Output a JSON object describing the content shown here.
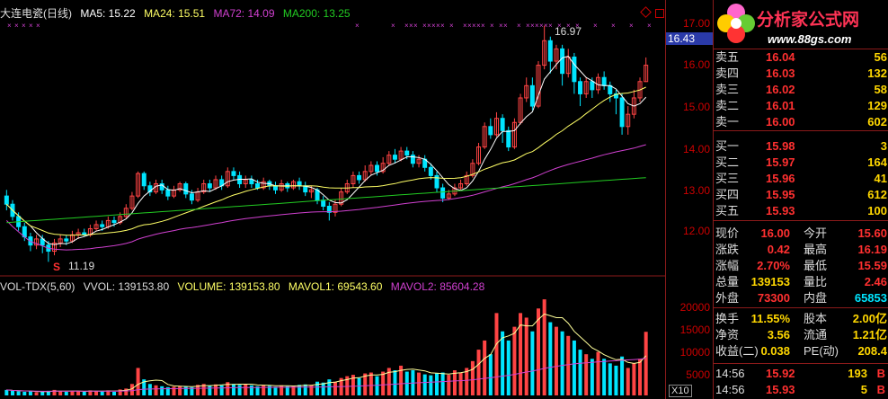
{
  "chart_header": {
    "title": "大连电瓷(日线)",
    "ma5": "MA5: 15.22",
    "ma24": "MA24: 15.51",
    "ma72": "MA72: 14.09",
    "ma200": "MA200: 13.25"
  },
  "volume_header": {
    "indicator": "VOL-TDX(5,60)",
    "vvol": "VVOL: 139153.80",
    "volume": "VOLUME: 139153.80",
    "mavol1": "MAVOL1: 69543.60",
    "mavol2": "MAVOL2: 85604.28"
  },
  "annotations": {
    "high": "16.97",
    "low": "11.19",
    "signal": "S"
  },
  "price_axis": {
    "ticks": [
      "17.00",
      "16.00",
      "15.00",
      "14.00",
      "13.00",
      "12.00"
    ],
    "current": "16.43"
  },
  "volume_axis": {
    "ticks": [
      "20000",
      "15000",
      "10000",
      "5000"
    ],
    "unit": "X10"
  },
  "colors": {
    "up": "#ff4444",
    "down": "#00e5ff",
    "ma5": "#ffffff",
    "ma24": "#ffff66",
    "ma72": "#d040d0",
    "ma200": "#22cc22"
  },
  "logo": {
    "name": "分析家公式网",
    "url": "www.88gs.com"
  },
  "orderbook": {
    "asks": [
      {
        "label": "卖五",
        "price": "16.04",
        "qty": "56"
      },
      {
        "label": "卖四",
        "price": "16.03",
        "qty": "132"
      },
      {
        "label": "卖三",
        "price": "16.02",
        "qty": "58"
      },
      {
        "label": "卖二",
        "price": "16.01",
        "qty": "129"
      },
      {
        "label": "卖一",
        "price": "16.00",
        "qty": "602"
      }
    ],
    "bids": [
      {
        "label": "买一",
        "price": "15.98",
        "qty": "3"
      },
      {
        "label": "买二",
        "price": "15.97",
        "qty": "164"
      },
      {
        "label": "买三",
        "price": "15.96",
        "qty": "41"
      },
      {
        "label": "买四",
        "price": "15.95",
        "qty": "612"
      },
      {
        "label": "买五",
        "price": "15.93",
        "qty": "100"
      }
    ]
  },
  "stats": [
    {
      "l1": "现价",
      "v1": "16.00",
      "c1": "#ff3030",
      "l2": "今开",
      "v2": "15.60",
      "c2": "#ff3030"
    },
    {
      "l1": "涨跌",
      "v1": "0.42",
      "c1": "#ff3030",
      "l2": "最高",
      "v2": "16.19",
      "c2": "#ff3030"
    },
    {
      "l1": "涨幅",
      "v1": "2.70%",
      "c1": "#ff3030",
      "l2": "最低",
      "v2": "15.59",
      "c2": "#ff3030"
    },
    {
      "l1": "总量",
      "v1": "139153",
      "c1": "#ffd700",
      "l2": "量比",
      "v2": "2.46",
      "c2": "#ff3030"
    },
    {
      "l1": "外盘",
      "v1": "73300",
      "c1": "#ff3030",
      "l2": "内盘",
      "v2": "65853",
      "c2": "#00e5ff"
    }
  ],
  "stats2": [
    {
      "l1": "换手",
      "v1": "11.55%",
      "c1": "#ffd700",
      "l2": "股本",
      "v2": "2.00亿",
      "c2": "#ffd700"
    },
    {
      "l1": "净资",
      "v1": "3.56",
      "c1": "#ffd700",
      "l2": "流通",
      "v2": "1.21亿",
      "c2": "#ffd700"
    },
    {
      "l1": "收益(二)",
      "v1": "0.038",
      "c1": "#ffd700",
      "l2": "PE(动)",
      "v2": "208.4",
      "c2": "#ffd700"
    }
  ],
  "trades": [
    {
      "time": "14:56",
      "price": "15.92",
      "qty": "193",
      "dir": "B"
    },
    {
      "time": "14:56",
      "price": "15.93",
      "qty": "5",
      "dir": "B"
    }
  ],
  "chart_data": {
    "type": "candlestick",
    "price_range": [
      11.0,
      17.2
    ],
    "volume_range": [
      0,
      22000
    ],
    "candles": [
      [
        12.8,
        12.6,
        12.95,
        12.45,
        "d"
      ],
      [
        12.6,
        12.3,
        12.7,
        12.2,
        "d"
      ],
      [
        12.3,
        12.05,
        12.4,
        11.95,
        "d"
      ],
      [
        12.05,
        11.8,
        12.15,
        11.7,
        "d"
      ],
      [
        11.8,
        11.6,
        11.9,
        11.45,
        "d"
      ],
      [
        11.6,
        11.75,
        11.85,
        11.5,
        "u"
      ],
      [
        11.75,
        11.6,
        11.85,
        11.4,
        "d"
      ],
      [
        11.6,
        11.45,
        11.7,
        11.19,
        "d"
      ],
      [
        11.45,
        11.65,
        11.75,
        11.35,
        "u"
      ],
      [
        11.65,
        11.75,
        11.85,
        11.55,
        "u"
      ],
      [
        11.75,
        11.7,
        11.85,
        11.6,
        "d"
      ],
      [
        11.7,
        11.85,
        11.95,
        11.65,
        "u"
      ],
      [
        11.85,
        11.9,
        12.0,
        11.75,
        "u"
      ],
      [
        11.9,
        11.85,
        12.0,
        11.8,
        "d"
      ],
      [
        11.85,
        12.0,
        12.1,
        11.8,
        "u"
      ],
      [
        12.0,
        12.1,
        12.2,
        11.95,
        "u"
      ],
      [
        12.1,
        12.05,
        12.2,
        11.95,
        "d"
      ],
      [
        12.05,
        12.2,
        12.3,
        12.0,
        "u"
      ],
      [
        12.2,
        12.15,
        12.3,
        12.05,
        "d"
      ],
      [
        12.15,
        12.3,
        12.4,
        12.1,
        "u"
      ],
      [
        12.3,
        12.5,
        12.6,
        12.25,
        "u"
      ],
      [
        12.5,
        12.8,
        12.9,
        12.45,
        "u"
      ],
      [
        12.8,
        13.35,
        13.4,
        12.75,
        "u"
      ],
      [
        13.35,
        13.05,
        13.4,
        12.95,
        "d"
      ],
      [
        13.05,
        12.9,
        13.15,
        12.8,
        "d"
      ],
      [
        12.9,
        13.1,
        13.2,
        12.85,
        "u"
      ],
      [
        13.1,
        12.95,
        13.2,
        12.85,
        "d"
      ],
      [
        12.95,
        12.8,
        13.05,
        12.7,
        "d"
      ],
      [
        12.8,
        12.95,
        13.05,
        12.75,
        "u"
      ],
      [
        12.95,
        13.1,
        13.15,
        12.9,
        "u"
      ],
      [
        13.1,
        12.85,
        13.15,
        12.75,
        "d"
      ],
      [
        12.85,
        12.7,
        12.95,
        12.6,
        "d"
      ],
      [
        12.7,
        12.9,
        13.0,
        12.65,
        "u"
      ],
      [
        12.9,
        13.1,
        13.2,
        12.85,
        "u"
      ],
      [
        13.1,
        13.0,
        13.2,
        12.9,
        "d"
      ],
      [
        13.0,
        13.2,
        13.3,
        12.95,
        "u"
      ],
      [
        13.2,
        13.05,
        13.3,
        12.95,
        "d"
      ],
      [
        13.05,
        13.4,
        13.5,
        13.0,
        "u"
      ],
      [
        13.4,
        13.3,
        13.5,
        13.2,
        "d"
      ],
      [
        13.3,
        13.1,
        13.4,
        13.0,
        "d"
      ],
      [
        13.1,
        13.2,
        13.3,
        13.0,
        "u"
      ],
      [
        13.2,
        13.1,
        13.3,
        13.0,
        "d"
      ],
      [
        13.1,
        13.0,
        13.2,
        12.95,
        "d"
      ],
      [
        13.0,
        13.15,
        13.25,
        12.95,
        "u"
      ],
      [
        13.15,
        13.05,
        13.2,
        12.95,
        "d"
      ],
      [
        13.05,
        12.95,
        13.15,
        12.85,
        "d"
      ],
      [
        12.95,
        13.1,
        13.2,
        12.9,
        "u"
      ],
      [
        13.1,
        13.0,
        13.15,
        12.9,
        "d"
      ],
      [
        13.0,
        13.15,
        13.2,
        12.95,
        "u"
      ],
      [
        13.15,
        13.05,
        13.25,
        12.95,
        "d"
      ],
      [
        13.05,
        12.9,
        13.15,
        12.8,
        "d"
      ],
      [
        12.9,
        12.95,
        13.05,
        12.75,
        "u"
      ],
      [
        12.95,
        12.7,
        13.0,
        12.6,
        "d"
      ],
      [
        12.7,
        12.55,
        12.8,
        12.45,
        "d"
      ],
      [
        12.55,
        12.4,
        12.65,
        12.2,
        "d"
      ],
      [
        12.4,
        12.6,
        12.7,
        12.3,
        "u"
      ],
      [
        12.6,
        12.9,
        13.0,
        12.55,
        "u"
      ],
      [
        12.9,
        13.1,
        13.2,
        12.85,
        "u"
      ],
      [
        13.1,
        13.3,
        13.4,
        13.0,
        "u"
      ],
      [
        13.3,
        13.2,
        13.4,
        13.1,
        "d"
      ],
      [
        13.2,
        13.4,
        13.55,
        13.15,
        "u"
      ],
      [
        13.4,
        13.55,
        13.65,
        13.3,
        "u"
      ],
      [
        13.55,
        13.4,
        13.65,
        13.3,
        "d"
      ],
      [
        13.4,
        13.6,
        13.75,
        13.35,
        "u"
      ],
      [
        13.6,
        13.8,
        13.9,
        13.55,
        "u"
      ],
      [
        13.8,
        13.7,
        13.95,
        13.6,
        "d"
      ],
      [
        13.7,
        13.9,
        14.0,
        13.65,
        "u"
      ],
      [
        13.9,
        13.8,
        14.0,
        13.7,
        "d"
      ],
      [
        13.8,
        13.6,
        13.9,
        13.5,
        "d"
      ],
      [
        13.6,
        13.7,
        13.8,
        13.5,
        "u"
      ],
      [
        13.7,
        13.5,
        13.8,
        13.4,
        "d"
      ],
      [
        13.5,
        13.3,
        13.6,
        13.2,
        "d"
      ],
      [
        13.3,
        13.0,
        13.4,
        12.9,
        "d"
      ],
      [
        13.0,
        12.75,
        13.1,
        12.65,
        "d"
      ],
      [
        12.75,
        12.85,
        12.95,
        12.7,
        "u"
      ],
      [
        12.85,
        13.0,
        13.1,
        12.8,
        "u"
      ],
      [
        13.0,
        13.1,
        13.2,
        12.95,
        "u"
      ],
      [
        13.1,
        13.3,
        13.4,
        13.05,
        "u"
      ],
      [
        13.3,
        13.6,
        13.7,
        13.25,
        "u"
      ],
      [
        13.6,
        14.0,
        14.1,
        13.55,
        "u"
      ],
      [
        14.0,
        14.5,
        14.6,
        13.95,
        "u"
      ],
      [
        14.5,
        14.3,
        14.7,
        14.2,
        "d"
      ],
      [
        14.3,
        14.7,
        14.85,
        14.25,
        "u"
      ],
      [
        14.7,
        14.4,
        14.8,
        14.1,
        "d"
      ],
      [
        14.4,
        14.0,
        14.5,
        13.9,
        "d"
      ],
      [
        14.0,
        14.6,
        14.7,
        13.95,
        "u"
      ],
      [
        14.6,
        15.2,
        15.3,
        14.55,
        "u"
      ],
      [
        15.2,
        15.5,
        15.7,
        15.1,
        "u"
      ],
      [
        15.5,
        15.0,
        15.7,
        14.9,
        "d"
      ],
      [
        15.0,
        16.0,
        16.1,
        14.95,
        "u"
      ],
      [
        16.0,
        16.6,
        16.97,
        15.9,
        "u"
      ],
      [
        16.6,
        16.1,
        16.7,
        15.8,
        "d"
      ],
      [
        16.1,
        16.4,
        16.5,
        15.9,
        "u"
      ],
      [
        16.4,
        15.8,
        16.5,
        15.5,
        "d"
      ],
      [
        15.8,
        16.2,
        16.4,
        15.7,
        "u"
      ],
      [
        16.2,
        15.6,
        16.3,
        15.3,
        "d"
      ],
      [
        15.6,
        15.3,
        15.7,
        15.0,
        "d"
      ],
      [
        15.3,
        15.6,
        15.7,
        15.2,
        "u"
      ],
      [
        15.6,
        15.4,
        15.7,
        15.2,
        "d"
      ],
      [
        15.4,
        15.7,
        15.8,
        15.3,
        "u"
      ],
      [
        15.7,
        15.5,
        15.85,
        15.4,
        "d"
      ],
      [
        15.5,
        15.3,
        15.6,
        15.1,
        "d"
      ],
      [
        15.3,
        15.2,
        15.4,
        14.8,
        "d"
      ],
      [
        15.2,
        14.5,
        15.3,
        14.3,
        "d"
      ],
      [
        14.5,
        14.8,
        15.0,
        14.3,
        "u"
      ],
      [
        14.8,
        15.2,
        15.4,
        14.7,
        "u"
      ],
      [
        15.2,
        15.6,
        15.7,
        15.1,
        "u"
      ],
      [
        15.6,
        16.0,
        16.19,
        15.59,
        "u"
      ]
    ],
    "volumes": [
      [
        1200,
        "d"
      ],
      [
        1000,
        "d"
      ],
      [
        900,
        "d"
      ],
      [
        800,
        "d"
      ],
      [
        900,
        "d"
      ],
      [
        700,
        "u"
      ],
      [
        800,
        "d"
      ],
      [
        1000,
        "d"
      ],
      [
        1200,
        "u"
      ],
      [
        900,
        "u"
      ],
      [
        800,
        "d"
      ],
      [
        900,
        "u"
      ],
      [
        1000,
        "u"
      ],
      [
        800,
        "d"
      ],
      [
        1100,
        "u"
      ],
      [
        900,
        "u"
      ],
      [
        900,
        "d"
      ],
      [
        1100,
        "u"
      ],
      [
        800,
        "d"
      ],
      [
        1300,
        "u"
      ],
      [
        1500,
        "u"
      ],
      [
        2500,
        "u"
      ],
      [
        6000,
        "u"
      ],
      [
        3500,
        "d"
      ],
      [
        2500,
        "d"
      ],
      [
        2200,
        "u"
      ],
      [
        2000,
        "d"
      ],
      [
        1800,
        "d"
      ],
      [
        1900,
        "u"
      ],
      [
        2100,
        "u"
      ],
      [
        2000,
        "d"
      ],
      [
        1800,
        "d"
      ],
      [
        2300,
        "u"
      ],
      [
        2500,
        "u"
      ],
      [
        2100,
        "d"
      ],
      [
        2400,
        "u"
      ],
      [
        2200,
        "d"
      ],
      [
        2900,
        "u"
      ],
      [
        2500,
        "d"
      ],
      [
        2300,
        "d"
      ],
      [
        2400,
        "u"
      ],
      [
        2200,
        "d"
      ],
      [
        2000,
        "d"
      ],
      [
        2300,
        "u"
      ],
      [
        2100,
        "d"
      ],
      [
        1900,
        "d"
      ],
      [
        2200,
        "u"
      ],
      [
        2000,
        "d"
      ],
      [
        2100,
        "u"
      ],
      [
        2300,
        "d"
      ],
      [
        2400,
        "d"
      ],
      [
        2200,
        "u"
      ],
      [
        3000,
        "d"
      ],
      [
        2800,
        "d"
      ],
      [
        3500,
        "d"
      ],
      [
        3000,
        "u"
      ],
      [
        3800,
        "u"
      ],
      [
        4200,
        "u"
      ],
      [
        4500,
        "u"
      ],
      [
        3800,
        "d"
      ],
      [
        4800,
        "u"
      ],
      [
        5000,
        "u"
      ],
      [
        4200,
        "d"
      ],
      [
        5200,
        "u"
      ],
      [
        6000,
        "u"
      ],
      [
        5500,
        "d"
      ],
      [
        6500,
        "u"
      ],
      [
        5200,
        "d"
      ],
      [
        5500,
        "d"
      ],
      [
        5000,
        "u"
      ],
      [
        4600,
        "d"
      ],
      [
        4400,
        "d"
      ],
      [
        4800,
        "d"
      ],
      [
        5000,
        "d"
      ],
      [
        4500,
        "u"
      ],
      [
        5500,
        "u"
      ],
      [
        5000,
        "u"
      ],
      [
        6000,
        "u"
      ],
      [
        7500,
        "u"
      ],
      [
        10000,
        "u"
      ],
      [
        12000,
        "u"
      ],
      [
        9000,
        "d"
      ],
      [
        18000,
        "u"
      ],
      [
        14000,
        "d"
      ],
      [
        12000,
        "d"
      ],
      [
        15000,
        "u"
      ],
      [
        18000,
        "u"
      ],
      [
        17000,
        "u"
      ],
      [
        14000,
        "d"
      ],
      [
        19000,
        "u"
      ],
      [
        21000,
        "u"
      ],
      [
        16000,
        "d"
      ],
      [
        15000,
        "u"
      ],
      [
        14000,
        "d"
      ],
      [
        13000,
        "u"
      ],
      [
        12000,
        "d"
      ],
      [
        10000,
        "d"
      ],
      [
        9000,
        "u"
      ],
      [
        8000,
        "d"
      ],
      [
        9500,
        "u"
      ],
      [
        8000,
        "d"
      ],
      [
        7000,
        "d"
      ],
      [
        6500,
        "d"
      ],
      [
        8500,
        "d"
      ],
      [
        6000,
        "u"
      ],
      [
        7000,
        "u"
      ],
      [
        8000,
        "u"
      ],
      [
        13900,
        "u"
      ]
    ]
  }
}
